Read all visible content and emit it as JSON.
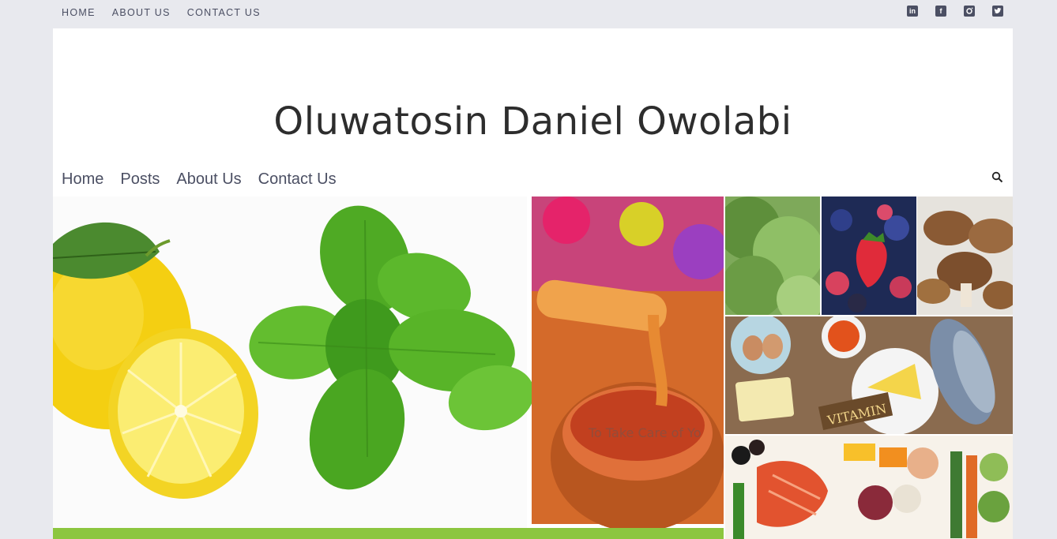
{
  "topbar": {
    "nav": [
      "HOME",
      "ABOUT US",
      "CONTACT US"
    ],
    "social_icons": [
      "linkedin-icon",
      "facebook-icon",
      "instagram-icon",
      "twitter-icon"
    ]
  },
  "site": {
    "title": "Oluwatosin Daniel Owolabi"
  },
  "main_nav": [
    "Home",
    "Posts",
    "About Us",
    "Contact Us"
  ],
  "hero": {
    "watermark": "To Take Care of Yo"
  },
  "colors": {
    "page_bg": "#e8e9ee",
    "nav_text": "#4b4f63",
    "title_text": "#2d2d2d",
    "banner_green": "#8cc63f"
  }
}
